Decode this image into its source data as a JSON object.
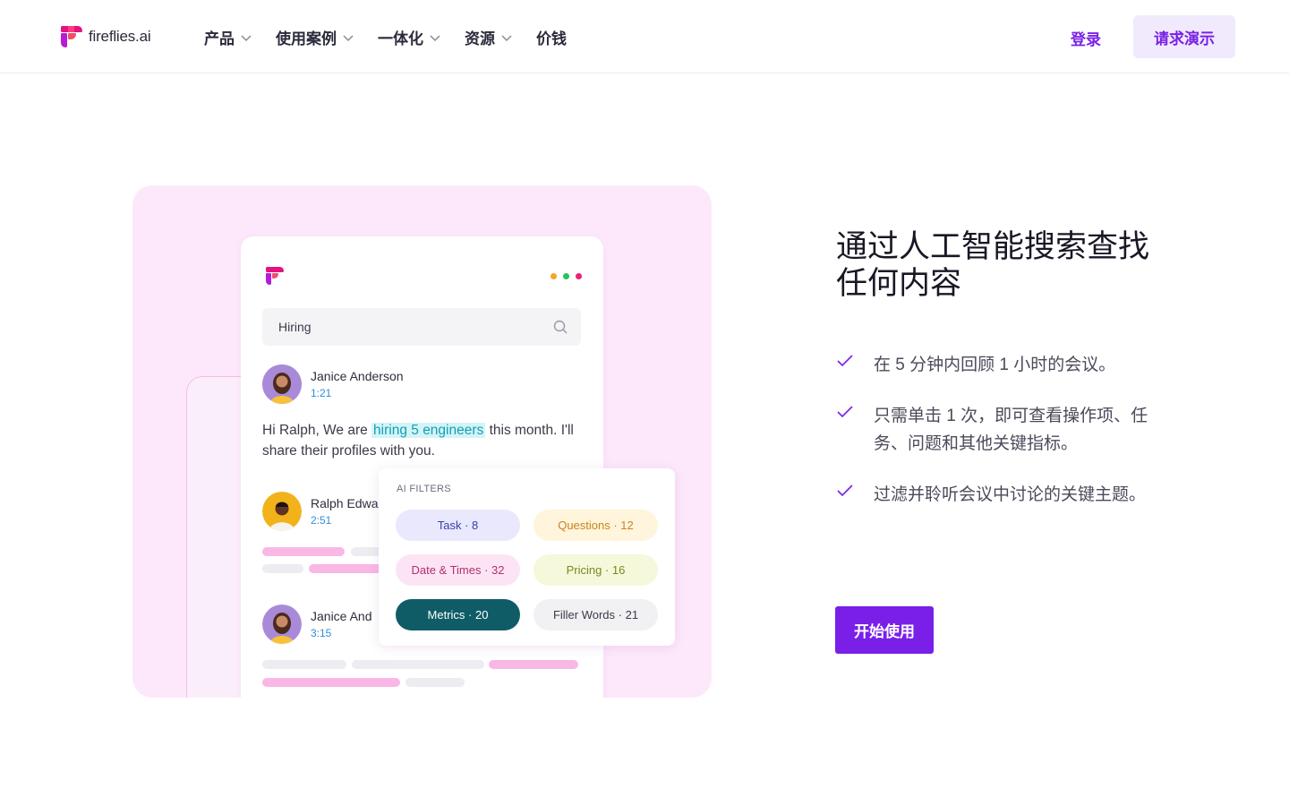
{
  "header": {
    "logo_text": "fireflies.ai",
    "nav": [
      {
        "label": "产品",
        "has_dropdown": true
      },
      {
        "label": "使用案例",
        "has_dropdown": true
      },
      {
        "label": "一体化",
        "has_dropdown": true
      },
      {
        "label": "资源",
        "has_dropdown": true
      },
      {
        "label": "价钱",
        "has_dropdown": false
      }
    ],
    "login_label": "登录",
    "demo_label": "请求演示"
  },
  "illustration": {
    "search_value": "Hiring",
    "entries": [
      {
        "name": "Janice Anderson",
        "time": "1:21"
      },
      {
        "name": "Ralph Edwa",
        "time": "2:51"
      },
      {
        "name": "Janice And",
        "time": "3:15"
      }
    ],
    "message": {
      "before": "Hi Ralph, We are ",
      "highlight": "hiring 5 engineers",
      "after": " this month. I'll share their profiles with you."
    },
    "filters_title": "AI FILTERS",
    "filters": [
      {
        "label": "Task · 8"
      },
      {
        "label": "Questions · 12"
      },
      {
        "label": "Date & Times · 32"
      },
      {
        "label": "Pricing · 16"
      },
      {
        "label": "Metrics · 20"
      },
      {
        "label": "Filler Words · 21"
      }
    ]
  },
  "content": {
    "heading": "通过人工智能搜索查找任何内容",
    "features": [
      "在 5 分钟内回顾 1 小时的会议。",
      "只需单击 1 次，即可查看操作项、任务、问题和其他关键指标。",
      "过滤并聆听会议中讨论的关键主题。"
    ],
    "cta_label": "开始使用"
  },
  "colors": {
    "brand_purple": "#7a1fe8",
    "illustration_bg": "#fde8fb"
  }
}
